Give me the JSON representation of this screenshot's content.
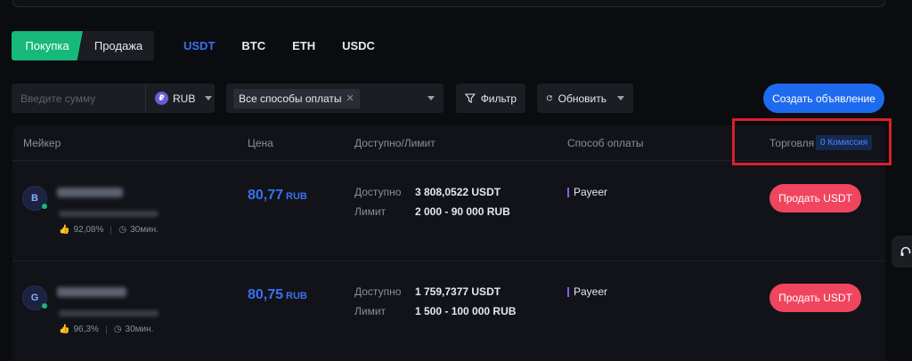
{
  "trade": {
    "buy_label": "Покупка",
    "sell_label": "Продажа"
  },
  "coins": [
    "USDT",
    "BTC",
    "ETH",
    "USDC"
  ],
  "active_coin": "USDT",
  "filters": {
    "amount_placeholder": "Введите сумму",
    "currency": "RUB",
    "currency_symbol": "₽",
    "payment_chip": "Все способы оплаты",
    "filter_label": "Фильтр",
    "refresh_label": "Обновить"
  },
  "create_ad_label": "Создать объявление",
  "table": {
    "headers": {
      "maker": "Мейкер",
      "price": "Цена",
      "available": "Доступно/Лимит",
      "payment": "Способ оплаты",
      "trade": "Торговля"
    },
    "commission_badge": "0 Комиссия",
    "rows": [
      {
        "avatar_letter": "B",
        "rating": "92,08%",
        "time": "30мин.",
        "price": "80,77",
        "currency": "RUB",
        "available_label": "Доступно",
        "available": "3 808,0522 USDT",
        "limit_label": "Лимит",
        "limit": "2 000 - 90 000 RUB",
        "payment_method": "Payeer",
        "action": "Продать USDT"
      },
      {
        "avatar_letter": "G",
        "rating": "96,3%",
        "time": "30мин.",
        "price": "80,75",
        "currency": "RUB",
        "available_label": "Доступно",
        "available": "1 759,7377 USDT",
        "limit_label": "Лимит",
        "limit": "1 500 - 100 000 RUB",
        "payment_method": "Payeer",
        "action": "Продать USDT"
      }
    ]
  },
  "colors": {
    "accent_blue": "#3b6ff5",
    "buy_green": "#16b979",
    "sell_red": "#f0455f",
    "highlight_red": "#d8212a"
  }
}
